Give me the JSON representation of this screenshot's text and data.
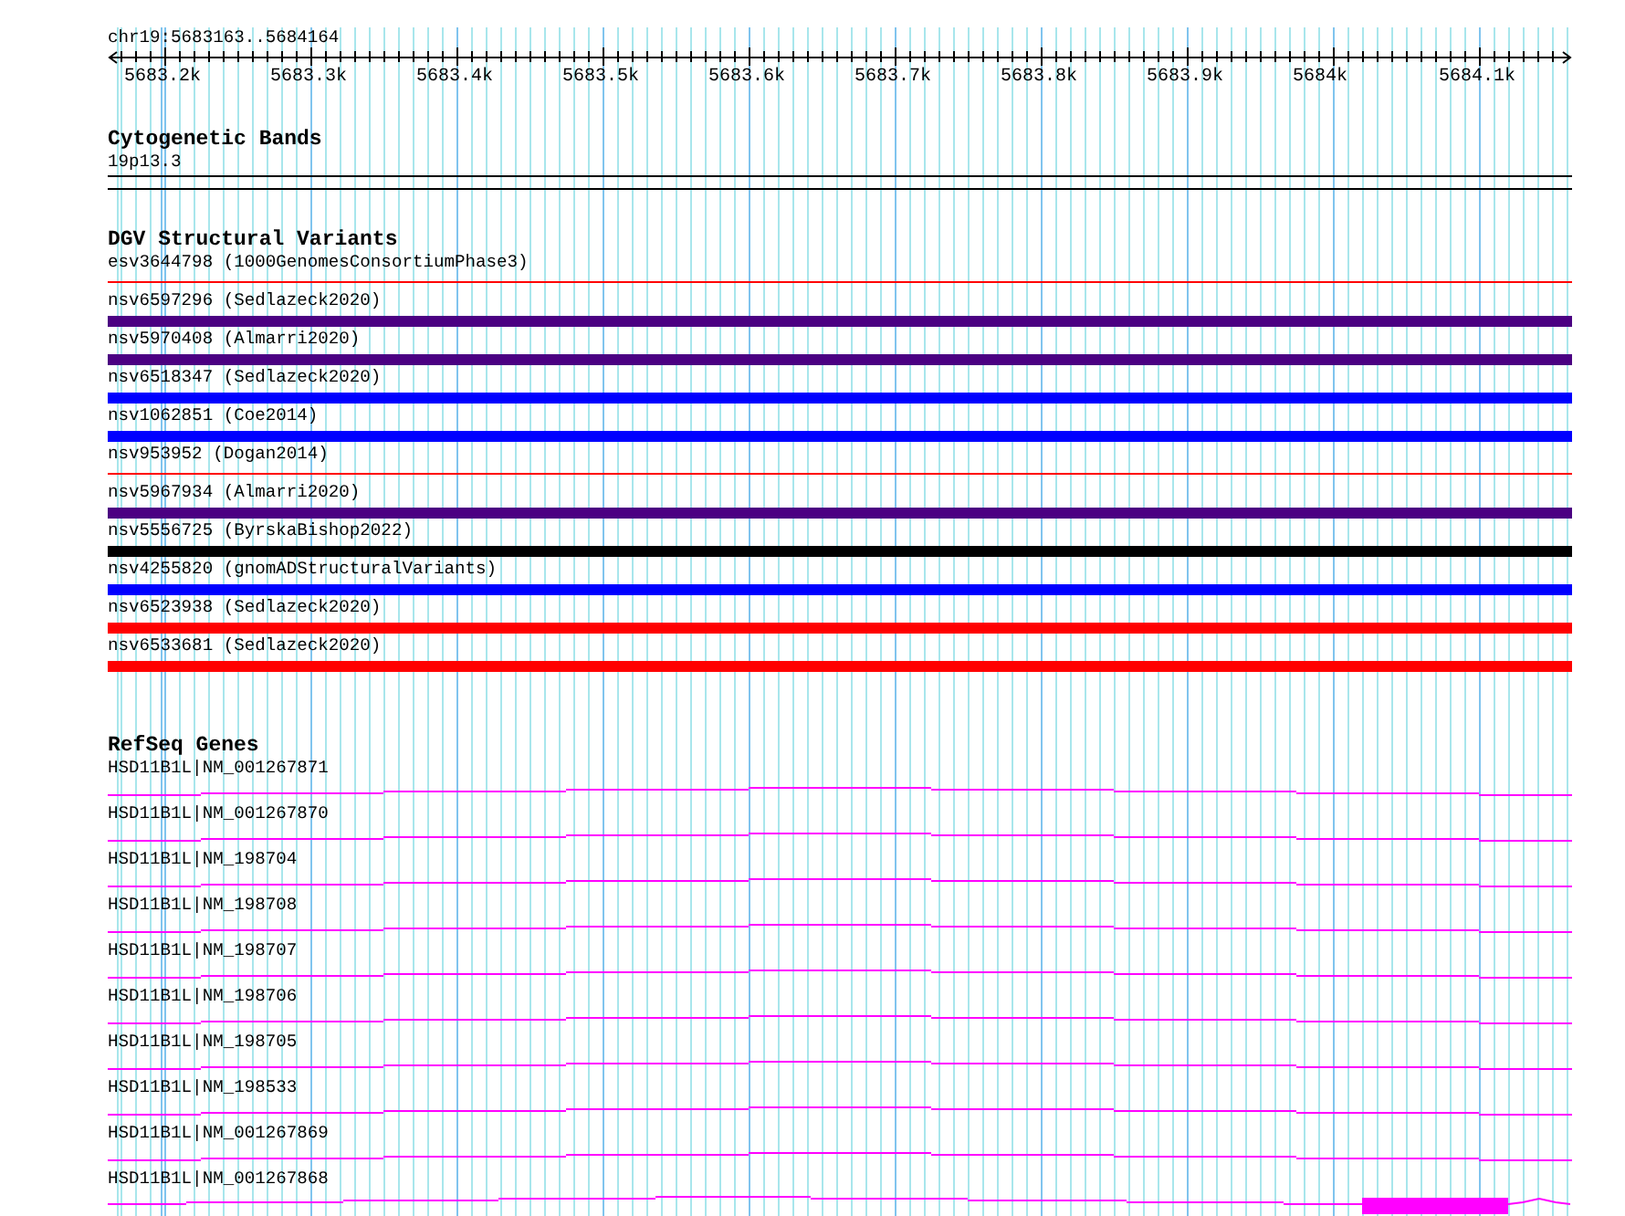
{
  "location": "chr19:5683163..5684164",
  "ruler": {
    "labels": [
      "5683.2k",
      "5683.3k",
      "5683.4k",
      "5683.5k",
      "5683.6k",
      "5683.7k",
      "5683.8k",
      "5683.9k",
      "5684k",
      "5684.1k"
    ]
  },
  "tracks": [
    {
      "title": "Cytogenetic Bands",
      "kind": "bands",
      "items": [
        {
          "label": "19p13.3"
        }
      ]
    },
    {
      "title": "DGV Structural Variants",
      "kind": "variants",
      "items": [
        {
          "label": "esv3644798 (1000GenomesConsortiumPhase3)",
          "kind": "thin",
          "color": "#ff0000"
        },
        {
          "label": "nsv6597296 (Sedlazeck2020)",
          "kind": "thick",
          "color": "#4b0082"
        },
        {
          "label": "nsv5970408 (Almarri2020)",
          "kind": "thick",
          "color": "#4b0082"
        },
        {
          "label": "nsv6518347 (Sedlazeck2020)",
          "kind": "thick",
          "color": "#0000ff"
        },
        {
          "label": "nsv1062851 (Coe2014)",
          "kind": "thick",
          "color": "#0000ff"
        },
        {
          "label": "nsv953952 (Dogan2014)",
          "kind": "thin",
          "color": "#ff0000"
        },
        {
          "label": "nsv5967934 (Almarri2020)",
          "kind": "thick",
          "color": "#4b0082"
        },
        {
          "label": "nsv5556725 (ByrskaBishop2022)",
          "kind": "thick",
          "color": "#000000"
        },
        {
          "label": "nsv4255820 (gnomADStructuralVariants)",
          "kind": "thick",
          "color": "#0000ff"
        },
        {
          "label": "nsv6523938 (Sedlazeck2020)",
          "kind": "thick",
          "color": "#ff0000"
        },
        {
          "label": "nsv6533681 (Sedlazeck2020)",
          "kind": "thick",
          "color": "#ff0000"
        }
      ]
    },
    {
      "title": "RefSeq Genes",
      "kind": "genes",
      "items": [
        {
          "label": "HSD11B1L|NM_001267871",
          "kind": "intron"
        },
        {
          "label": "HSD11B1L|NM_001267870",
          "kind": "intron"
        },
        {
          "label": "HSD11B1L|NM_198704",
          "kind": "intron"
        },
        {
          "label": "HSD11B1L|NM_198708",
          "kind": "intron"
        },
        {
          "label": "HSD11B1L|NM_198707",
          "kind": "intron"
        },
        {
          "label": "HSD11B1L|NM_198706",
          "kind": "intron"
        },
        {
          "label": "HSD11B1L|NM_198705",
          "kind": "intron"
        },
        {
          "label": "HSD11B1L|NM_198533",
          "kind": "intron"
        },
        {
          "label": "HSD11B1L|NM_001267869",
          "kind": "intron"
        },
        {
          "label": "HSD11B1L|NM_001267868",
          "kind": "exon"
        }
      ]
    }
  ]
}
